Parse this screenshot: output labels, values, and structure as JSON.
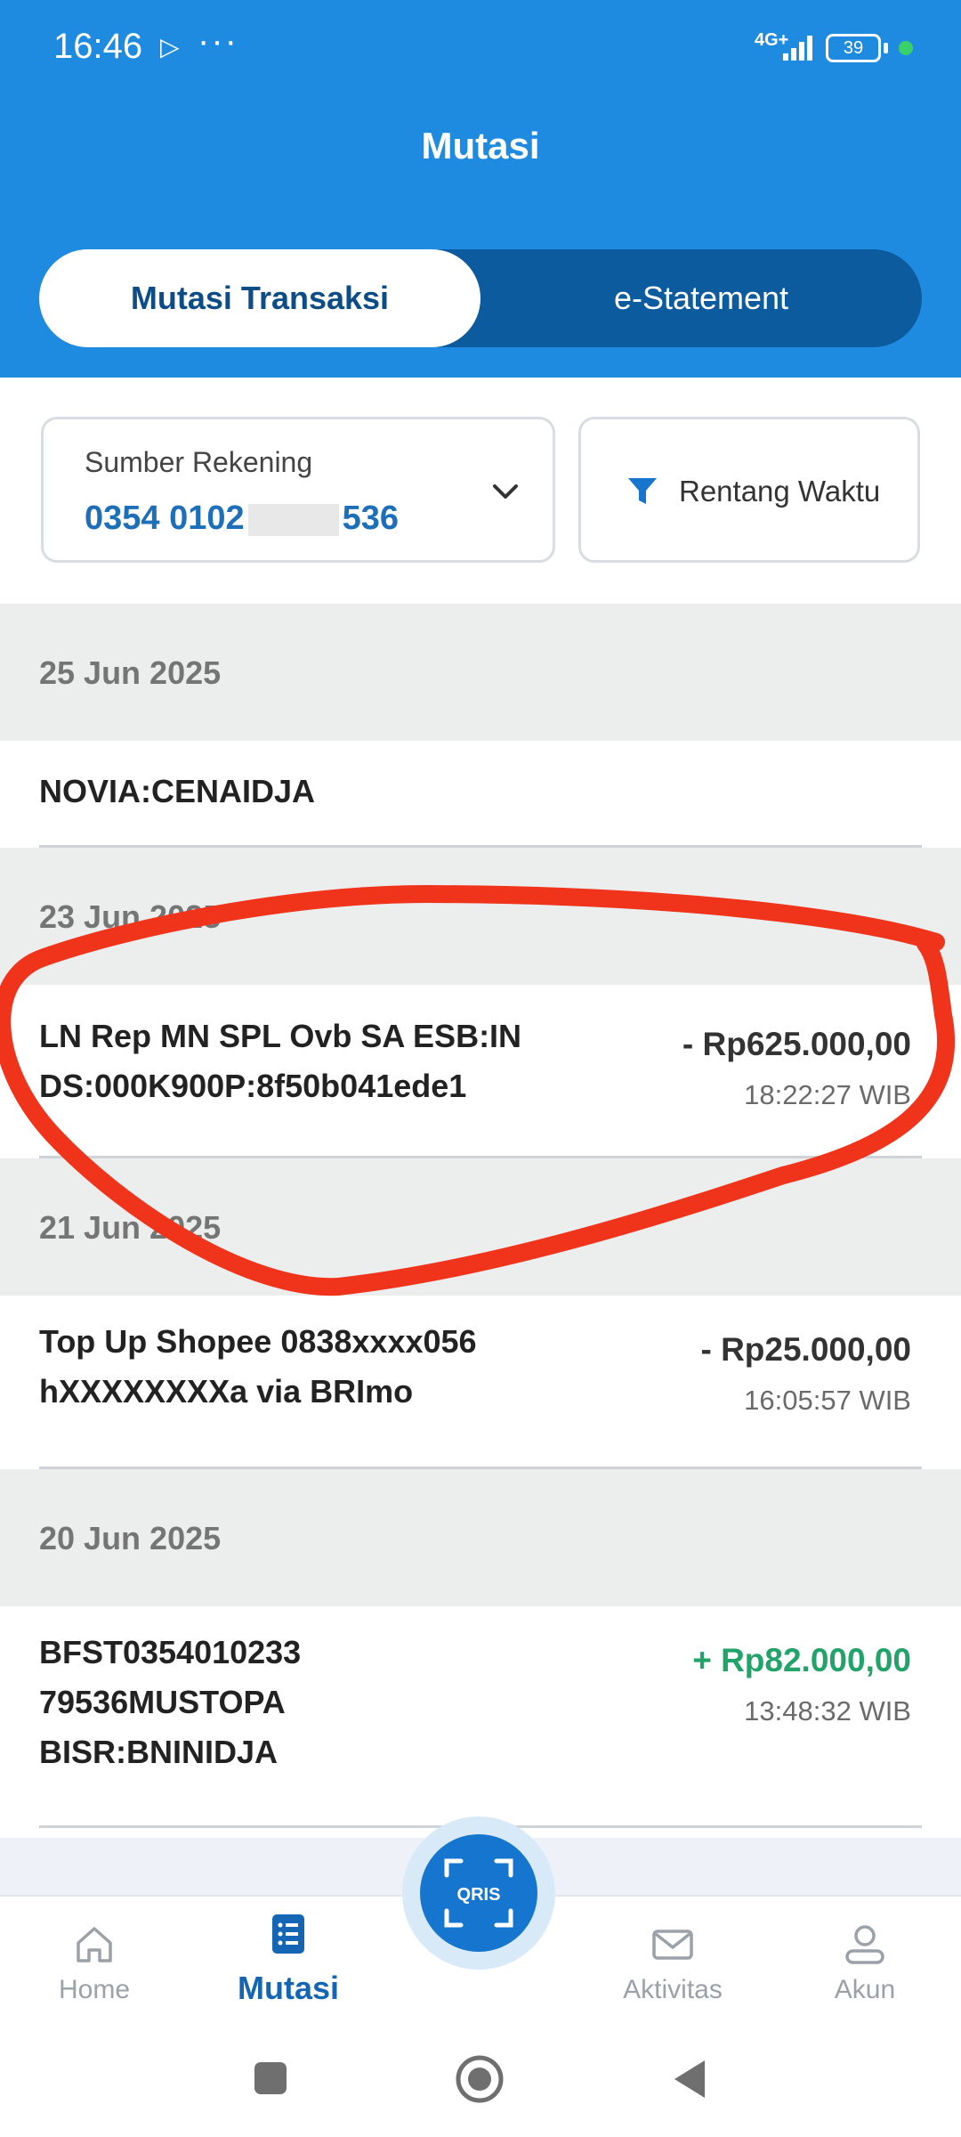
{
  "status_bar": {
    "time": "16:46",
    "network": "4G+",
    "battery": "39"
  },
  "header": {
    "title": "Mutasi",
    "tabs": [
      {
        "label": "Mutasi Transaksi",
        "active": true
      },
      {
        "label": "e-Statement",
        "active": false
      }
    ]
  },
  "filters": {
    "source_label": "Sumber Rekening",
    "source_prefix": "0354 0102",
    "source_suffix": "536",
    "time_filter_label": "Rentang Waktu"
  },
  "transactions": {
    "group_1": {
      "date": "25 Jun 2025",
      "partial_desc_line2": "NOVIA:CENAIDJA"
    },
    "group_2": {
      "date": "23 Jun 2025",
      "desc_line1": "LN Rep MN SPL Ovb SA ESB:IN",
      "desc_line2": "DS:000K900P:8f50b041ede1",
      "amount": "- Rp625.000,00",
      "time": "18:22:27 WIB"
    },
    "group_3": {
      "date": "21 Jun 2025",
      "desc_line1": "Top Up Shopee 0838xxxx056",
      "desc_line2": "hXXXXXXXXa via BRImo",
      "amount": "- Rp25.000,00",
      "time": "16:05:57 WIB"
    },
    "group_4": {
      "date": "20 Jun 2025",
      "desc_line1": "BFST0354010233",
      "desc_line2": "79536MUSTOPA",
      "desc_line3": "BISR:BNINIDJA",
      "amount": "+ Rp82.000,00",
      "time": "13:48:32 WIB"
    }
  },
  "bottom_nav": {
    "home": "Home",
    "mutasi": "Mutasi",
    "aktivitas": "Aktivitas",
    "akun": "Akun",
    "qris": "QRIS"
  },
  "colors": {
    "header_blue": "#1f8be0",
    "tab_dark": "#0d5b9f",
    "account_blue": "#1c6fb8",
    "credit_green": "#22a36a",
    "annotation_red": "#f0331b"
  }
}
